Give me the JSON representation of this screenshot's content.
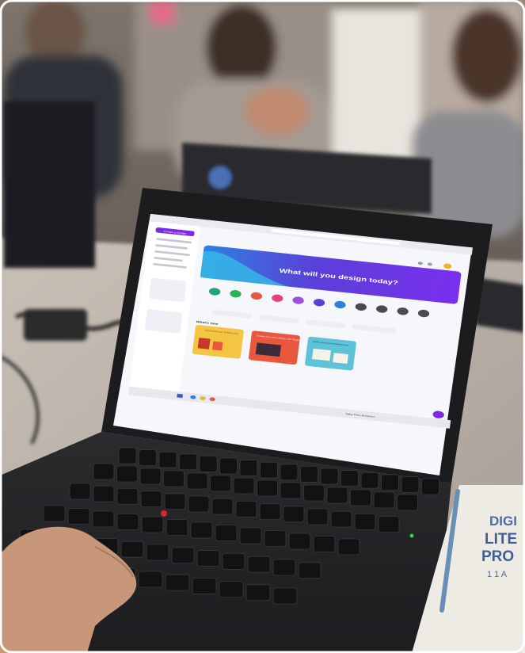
{
  "screen": {
    "headline": "What will you design today?",
    "section_title": "What's new",
    "create_button": "Create a design",
    "quick_actions": [
      "",
      "",
      "",
      "",
      "",
      "",
      "",
      "",
      "",
      "",
      ""
    ],
    "cards": [
      {
        "text": "Unlock the joy of discovery",
        "color": "#f4c542"
      },
      {
        "text": "Create your own design with Magic",
        "color": "#e9573f"
      },
      {
        "text": "Make your presentations pop",
        "color": "#5ec3d8"
      }
    ],
    "banner_colors": [
      "#2f7fe0",
      "#5b3fd8",
      "#7b2ff0",
      "#36b6e6"
    ],
    "taskbar_alert": "India Fires Reservoi..."
  },
  "booklet": {
    "line1": "DIGI",
    "line2": "LITE",
    "line3": "PRO",
    "line4": "1 1 A"
  }
}
